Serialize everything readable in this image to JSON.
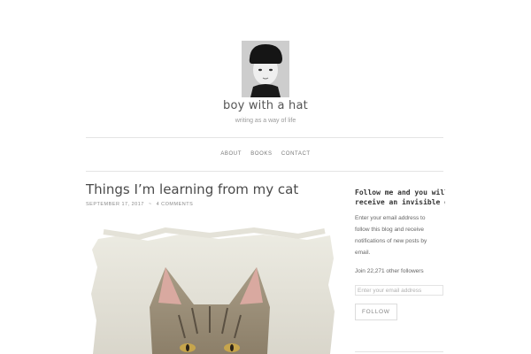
{
  "site": {
    "title": "boy with a hat",
    "tagline": "writing as a way of life"
  },
  "nav": {
    "items": [
      {
        "label": "ABOUT"
      },
      {
        "label": "BOOKS"
      },
      {
        "label": "CONTACT"
      }
    ]
  },
  "post": {
    "title": "Things I’m learning from my cat",
    "date": "SEPTEMBER 17, 2017",
    "separator": "~",
    "comments": "4 COMMENTS"
  },
  "sidebar": {
    "follow_title_line1": "Follow me and you will",
    "follow_title_line2": "receive an invisible g",
    "follow_text": "Enter your email address to follow this blog and receive notifications of new posts by email.",
    "followers_text": "Join 22,271 other followers",
    "email_placeholder": "Enter your email address",
    "follow_button": "FOLLOW"
  },
  "colors": {
    "background": "#ffffff",
    "text": "#444444",
    "muted": "#999999",
    "rule": "#e4e4e4"
  }
}
